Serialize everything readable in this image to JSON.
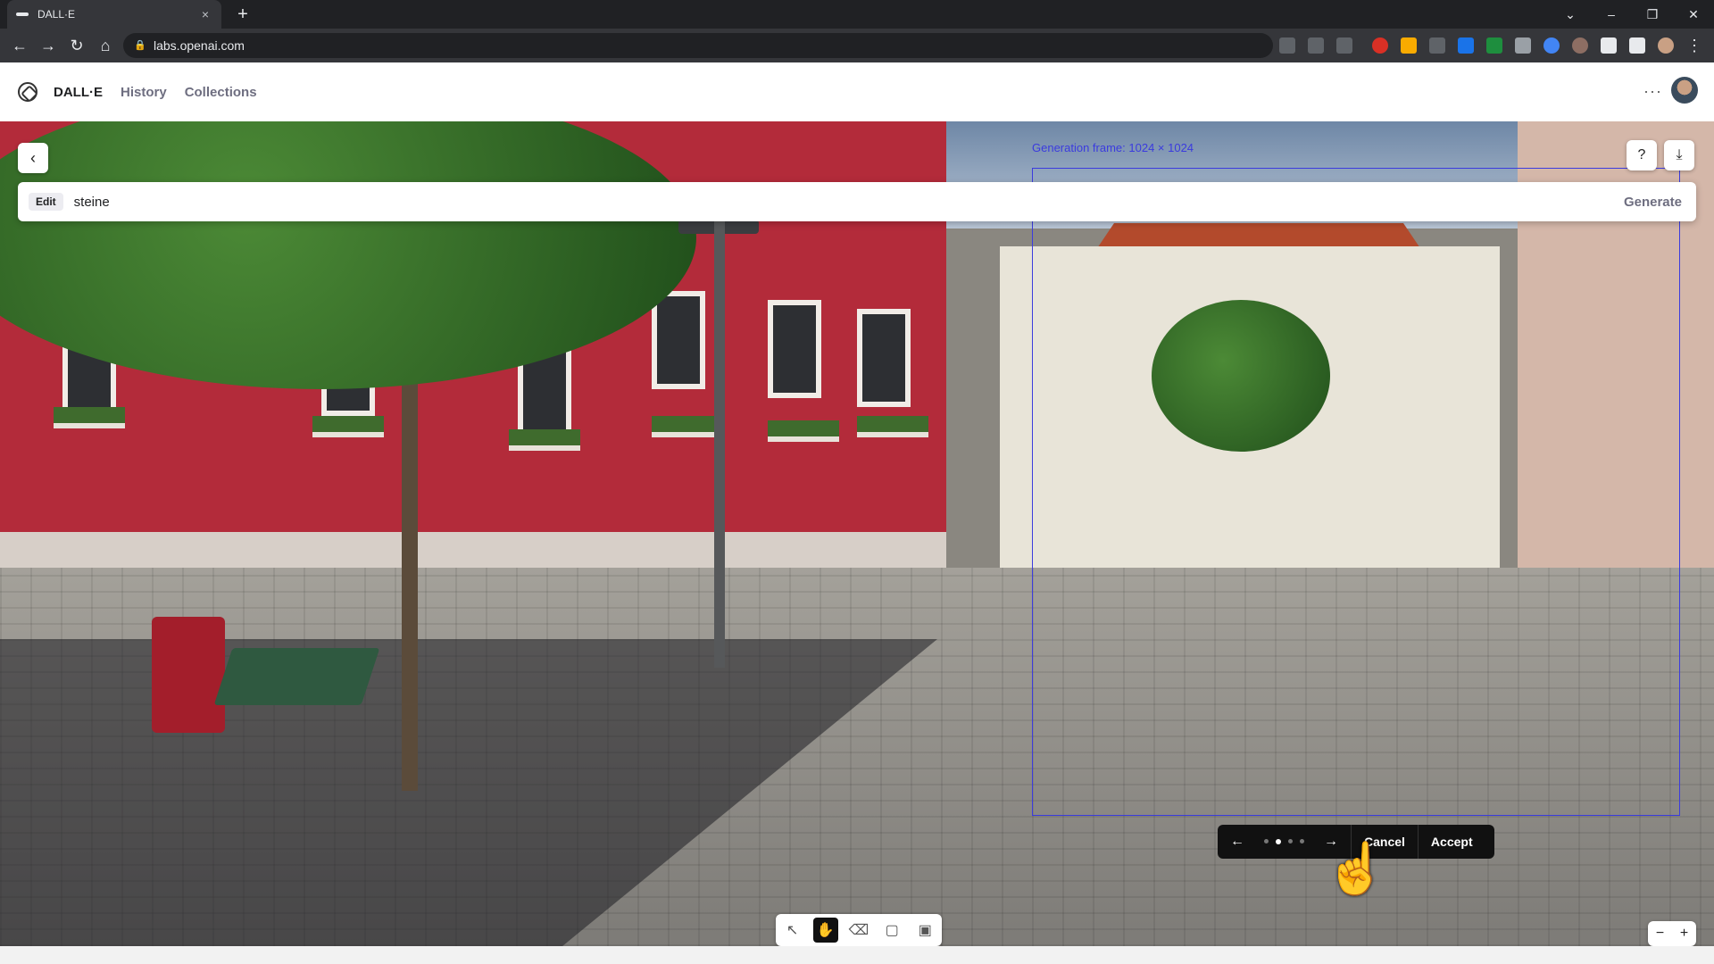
{
  "browser": {
    "tab_title": "DALL·E",
    "tab_close": "×",
    "new_tab": "+",
    "url": "labs.openai.com",
    "window_controls": [
      "⌄",
      "–",
      "❐",
      "✕"
    ]
  },
  "app": {
    "name": "DALL·E",
    "nav": [
      "History",
      "Collections"
    ],
    "more": "···"
  },
  "prompt": {
    "mode_label": "Edit",
    "value": "steine",
    "generate_label": "Generate"
  },
  "canvas": {
    "frame_label": "Generation frame: 1024 × 1024"
  },
  "variant_bar": {
    "prev": "←",
    "next": "→",
    "dot_count": 4,
    "active_dot": 1,
    "cancel_label": "Cancel",
    "accept_label": "Accept"
  },
  "tools": [
    "select-icon",
    "hand-icon",
    "eraser-icon",
    "add-frame-icon",
    "upload-image-icon"
  ],
  "active_tool": "hand-icon",
  "zoom": {
    "out": "−",
    "in": "+"
  }
}
